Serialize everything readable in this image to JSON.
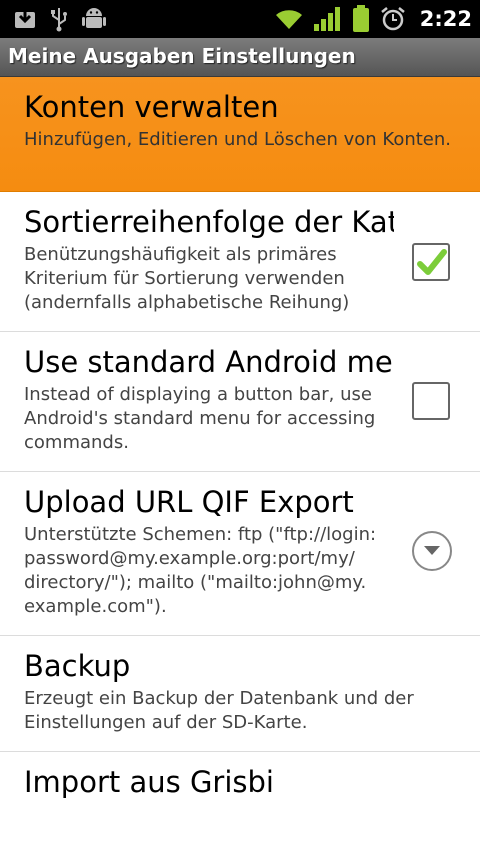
{
  "status_bar": {
    "left_icons": [
      "download-icon",
      "usb-icon",
      "android-debug-icon"
    ],
    "right_icons": [
      "wifi-icon",
      "signal-icon",
      "battery-icon",
      "alarm-icon"
    ],
    "time": "2:22"
  },
  "title_bar": {
    "title": "Meine Ausgaben Einstellungen"
  },
  "preferences": [
    {
      "title": "Konten verwalten",
      "summary": "Hinzufügen, Editieren und Löschen von Konten.",
      "selected": true
    },
    {
      "title": "Sortierreihenfolge der Kategorien",
      "summary": "Benützungshäufigkeit als primäres Kriterium für Sortierung verwenden (andernfalls alphabetische Reihung)",
      "widget": "checkbox",
      "checked": true
    },
    {
      "title": "Use standard Android menu",
      "summary": "Instead of displaying a button bar, use Android's standard menu for accessing commands.",
      "widget": "checkbox",
      "checked": false
    },
    {
      "title": "Upload URL QIF Export",
      "summary": "Unterstützte Schemen: ftp (\"ftp://login: password@my.example.org:port/my/ directory/\"); mailto (\"mailto:john@my. example.com\").",
      "widget": "dropdown"
    },
    {
      "title": "Backup",
      "summary": "Erzeugt ein Backup der Datenbank und der Einstellungen auf der SD-Karte."
    },
    {
      "title": "Import aus Grisbi",
      "summary": ""
    }
  ],
  "colors": {
    "selected_background": "#f7931e",
    "status_icon_green": "#9acd32",
    "check_green": "#7ccd3a"
  }
}
